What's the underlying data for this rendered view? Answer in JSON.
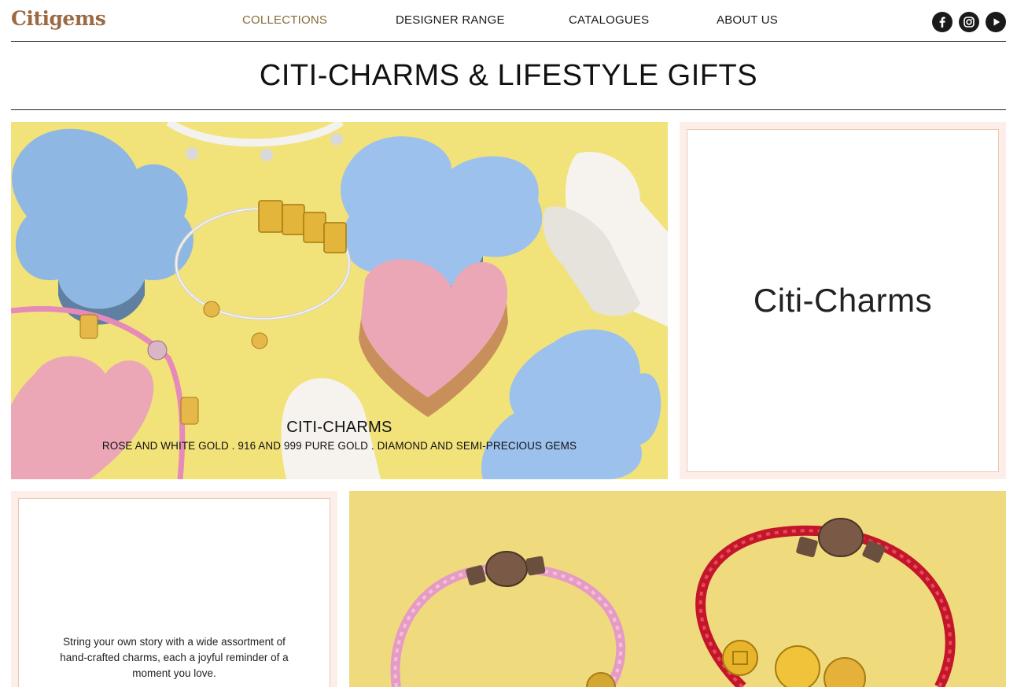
{
  "header": {
    "logo": "Citigems",
    "nav": [
      {
        "label": "COLLECTIONS",
        "active": true
      },
      {
        "label": "DESIGNER RANGE",
        "active": false
      },
      {
        "label": "CATALOGUES",
        "active": false
      },
      {
        "label": "ABOUT US",
        "active": false
      }
    ],
    "social": [
      "facebook-icon",
      "instagram-icon",
      "youtube-play-icon"
    ]
  },
  "page": {
    "title": "CITI-CHARMS & LIFESTYLE GIFTS"
  },
  "hero": {
    "caption_title": "CITI-CHARMS",
    "caption_subtitle": "ROSE AND WHITE GOLD . 916 AND 999 PURE GOLD . DIAMOND AND SEMI-PRECIOUS GEMS"
  },
  "category": {
    "label": "Citi-Charms"
  },
  "description": {
    "text": "String your own story with a wide assortment of hand-crafted charms, each a joyful reminder of a moment you love."
  },
  "colors": {
    "accent": "#8a6a3a",
    "logo": "#9b6a43",
    "panel_bg": "#fdeeea",
    "panel_border": "#e8c9b0",
    "hero_bg": "#f2e27a"
  }
}
